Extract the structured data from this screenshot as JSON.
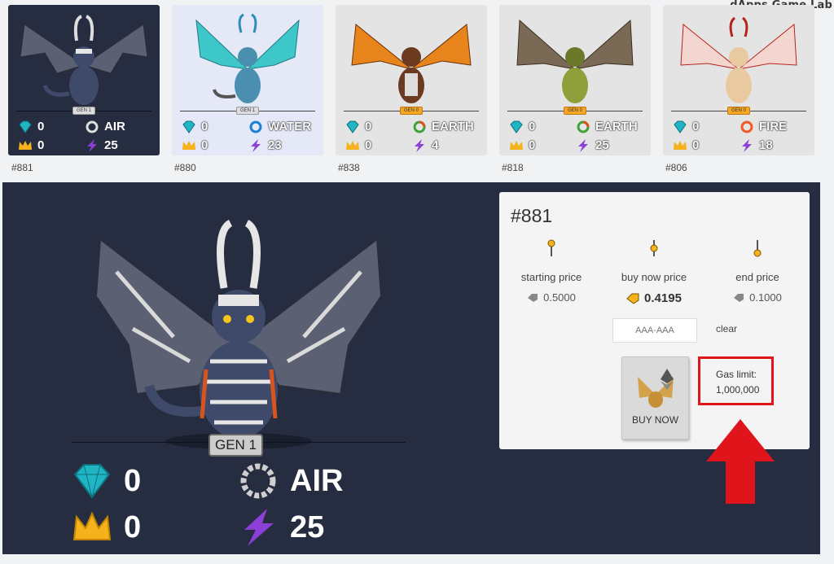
{
  "watermark": "dApps Game Lab",
  "cards": [
    {
      "id": "#881",
      "gen": "GEN 1",
      "gems": "0",
      "crowns": "0",
      "element": "AIR",
      "energy": "25"
    },
    {
      "id": "#880",
      "gen": "GEN 1",
      "gems": "0",
      "crowns": "0",
      "element": "WATER",
      "energy": "23"
    },
    {
      "id": "#838",
      "gen": "GEN 0",
      "gems": "0",
      "crowns": "0",
      "element": "EARTH",
      "energy": "4"
    },
    {
      "id": "#818",
      "gen": "GEN 0",
      "gems": "0",
      "crowns": "0",
      "element": "EARTH",
      "energy": "25"
    },
    {
      "id": "#806",
      "gen": "GEN 0",
      "gems": "0",
      "crowns": "0",
      "element": "FIRE",
      "energy": "18"
    }
  ],
  "detail": {
    "gen": "GEN 1",
    "gems": "0",
    "crowns": "0",
    "element": "AIR",
    "energy": "25"
  },
  "auction": {
    "title": "#881",
    "starting_label": "starting price",
    "starting_value": "0.5000",
    "buynow_label": "buy now price",
    "buynow_value": "0.4195",
    "end_label": "end price",
    "end_value": "0.1000",
    "code_placeholder": "AAA-AAA",
    "clear_label": "clear",
    "buy_label": "BUY NOW",
    "gas_label": "Gas limit:",
    "gas_value": "1,000,000"
  },
  "colors": {
    "panel": "#262d40",
    "highlight": "#e0141b",
    "gem": "#1fb5c4",
    "crown": "#f5b21a",
    "energy": "#8b3fd6"
  },
  "icons": [
    "gem-icon",
    "crown-icon",
    "energy-icon",
    "air-element-icon",
    "water-element-icon",
    "earth-element-icon",
    "fire-element-icon",
    "price-tag-icon",
    "pin-icon",
    "ethereum-icon"
  ]
}
